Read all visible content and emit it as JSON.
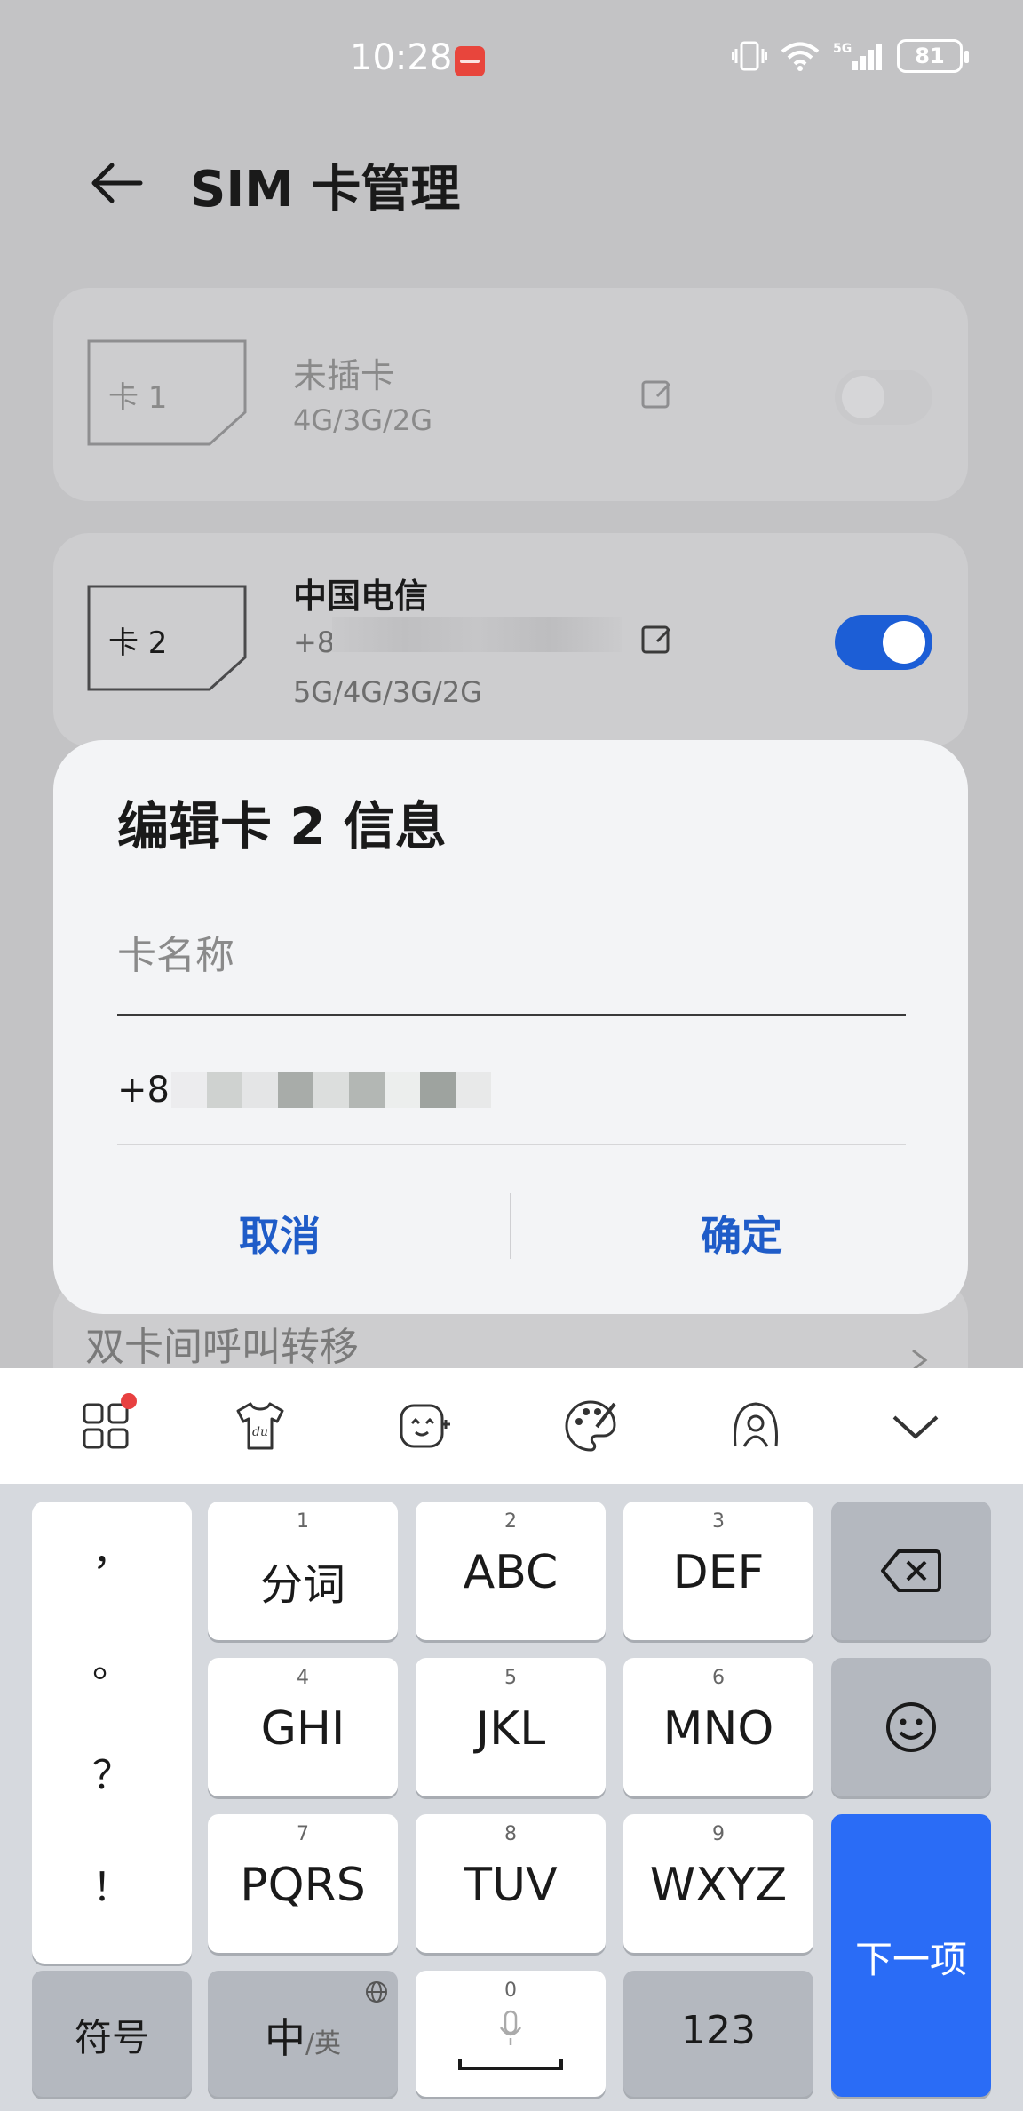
{
  "status_bar": {
    "time": "10:28",
    "battery": "81",
    "icons": [
      "vibrate-icon",
      "wifi-icon",
      "signal-5g-icon",
      "battery-icon"
    ]
  },
  "header": {
    "title": "SIM 卡管理",
    "back_icon": "back-arrow-icon"
  },
  "sim_cards": [
    {
      "chip_label": "卡 1",
      "name": "未插卡",
      "network": "4G/3G/2G",
      "enabled": false
    },
    {
      "chip_label": "卡 2",
      "name": "中国电信",
      "number_prefix": "+8",
      "network": "5G/4G/3G/2G",
      "enabled": true
    }
  ],
  "behind_dialog": {
    "row_label": "双卡间呼叫转移"
  },
  "dialog": {
    "title": "编辑卡 2 信息",
    "name_placeholder": "卡名称",
    "name_value": "",
    "number_prefix": "+8",
    "cancel_label": "取消",
    "confirm_label": "确定"
  },
  "keyboard": {
    "toolbar_icons": [
      "grid-menu-icon",
      "skin-icon",
      "emoji-face-icon",
      "palette-icon",
      "assistant-icon",
      "collapse-keyboard-icon"
    ],
    "punctuation": [
      "，",
      "。",
      "？",
      "！"
    ],
    "rows": [
      [
        {
          "num": "1",
          "label": "分词"
        },
        {
          "num": "2",
          "label": "ABC"
        },
        {
          "num": "3",
          "label": "DEF"
        }
      ],
      [
        {
          "num": "4",
          "label": "GHI"
        },
        {
          "num": "5",
          "label": "JKL"
        },
        {
          "num": "6",
          "label": "MNO"
        }
      ],
      [
        {
          "num": "7",
          "label": "PQRS"
        },
        {
          "num": "8",
          "label": "TUV"
        },
        {
          "num": "9",
          "label": "WXYZ"
        }
      ]
    ],
    "bottom": {
      "symbols": "符号",
      "lang_main": "中",
      "lang_alt": "/英",
      "space_num": "0",
      "numbers": "123"
    },
    "next_label": "下一项",
    "colors": {
      "accent": "#2a6cf6",
      "toggle_on": "#1c5ed6",
      "dialog_button": "#1f5cc8"
    }
  }
}
